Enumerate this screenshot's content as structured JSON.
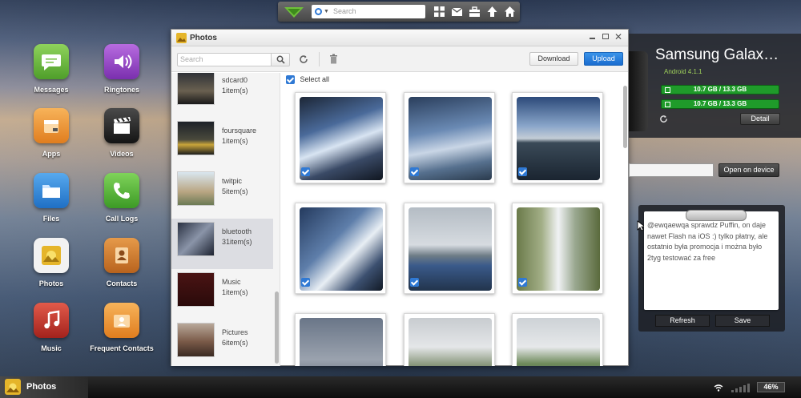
{
  "desktop": {
    "apps": [
      {
        "label": "Messages",
        "icon": "messages-icon",
        "color": "#62b33a"
      },
      {
        "label": "Ringtones",
        "icon": "ringtones-icon",
        "color": "#8a3fb8"
      },
      {
        "label": "Apps",
        "icon": "apps-icon",
        "color": "#f0912d"
      },
      {
        "label": "Videos",
        "icon": "videos-icon",
        "color": "#2a2a2a"
      },
      {
        "label": "Files",
        "icon": "files-icon",
        "color": "#2f86d6"
      },
      {
        "label": "Call Logs",
        "icon": "call-logs-icon",
        "color": "#52b43a"
      },
      {
        "label": "Photos",
        "icon": "photos-icon",
        "color": "#e6b82c"
      },
      {
        "label": "Contacts",
        "icon": "contacts-icon",
        "color": "#c9782b"
      },
      {
        "label": "Music",
        "icon": "music-icon",
        "color": "#c9302c"
      },
      {
        "label": "Frequent Contacts",
        "icon": "frequent-contacts-icon",
        "color": "#f0912d"
      }
    ]
  },
  "topbar": {
    "search_placeholder": "Search",
    "icons": [
      "grid-icon",
      "mail-icon",
      "toolbox-icon",
      "upload-arrow-icon",
      "home-icon"
    ]
  },
  "photos_window": {
    "title": "Photos",
    "search_placeholder": "Search",
    "download_label": "Download",
    "upload_label": "Upload",
    "select_all_label": "Select all",
    "albums": [
      {
        "name": "sdcard0",
        "count": "1item(s)"
      },
      {
        "name": "foursquare",
        "count": "1item(s)"
      },
      {
        "name": "twitpic",
        "count": "5item(s)"
      },
      {
        "name": "bluetooth",
        "count": "31item(s)"
      },
      {
        "name": "Music",
        "count": "1item(s)"
      },
      {
        "name": "Pictures",
        "count": "6item(s)"
      }
    ]
  },
  "device": {
    "name": "Samsung Galax…",
    "os": "Android 4.1.1",
    "storage": [
      "10.7 GB / 13.3 GB",
      "10.7 GB / 13.3 GB"
    ],
    "detail_label": "Detail",
    "open_on_device_label": "Open on device"
  },
  "note": {
    "text": "@ewqaewqa sprawdz Puffin, on daje nawet Flash na iOS :) tylko płatny, ale ostatnio była promocja i można było 2tyg testować za free",
    "refresh_label": "Refresh",
    "save_label": "Save"
  },
  "taskbar": {
    "active_label": "Photos",
    "battery": "46%"
  },
  "colors": {
    "accent": "#1b6ccf",
    "storage_green": "#1f9b2a"
  }
}
